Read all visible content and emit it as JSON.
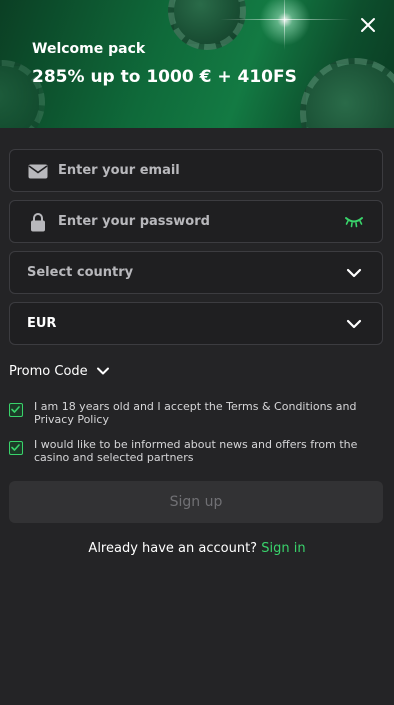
{
  "banner": {
    "subtitle": "Welcome pack",
    "title": "285% up to 1000 € + 410FS"
  },
  "form": {
    "email_placeholder": "Enter your email",
    "password_placeholder": "Enter your password",
    "country_placeholder": "Select country",
    "currency_value": "EUR",
    "promo_label": "Promo Code"
  },
  "consents": [
    {
      "text": "I am 18 years old and I accept the Terms & Conditions and Privacy Policy",
      "checked": true
    },
    {
      "text": "I would like to be informed about news and offers from the casino and selected partners",
      "checked": true
    }
  ],
  "signup_label": "Sign up",
  "account": {
    "prompt": "Already have an account?",
    "signin_label": "Sign in"
  },
  "colors": {
    "accent": "#39d36b",
    "background": "#242426",
    "field_background": "#1f1f21"
  },
  "icons": [
    "close-icon",
    "envelope-icon",
    "lock-icon",
    "eye-closed-icon",
    "chevron-down-icon"
  ]
}
